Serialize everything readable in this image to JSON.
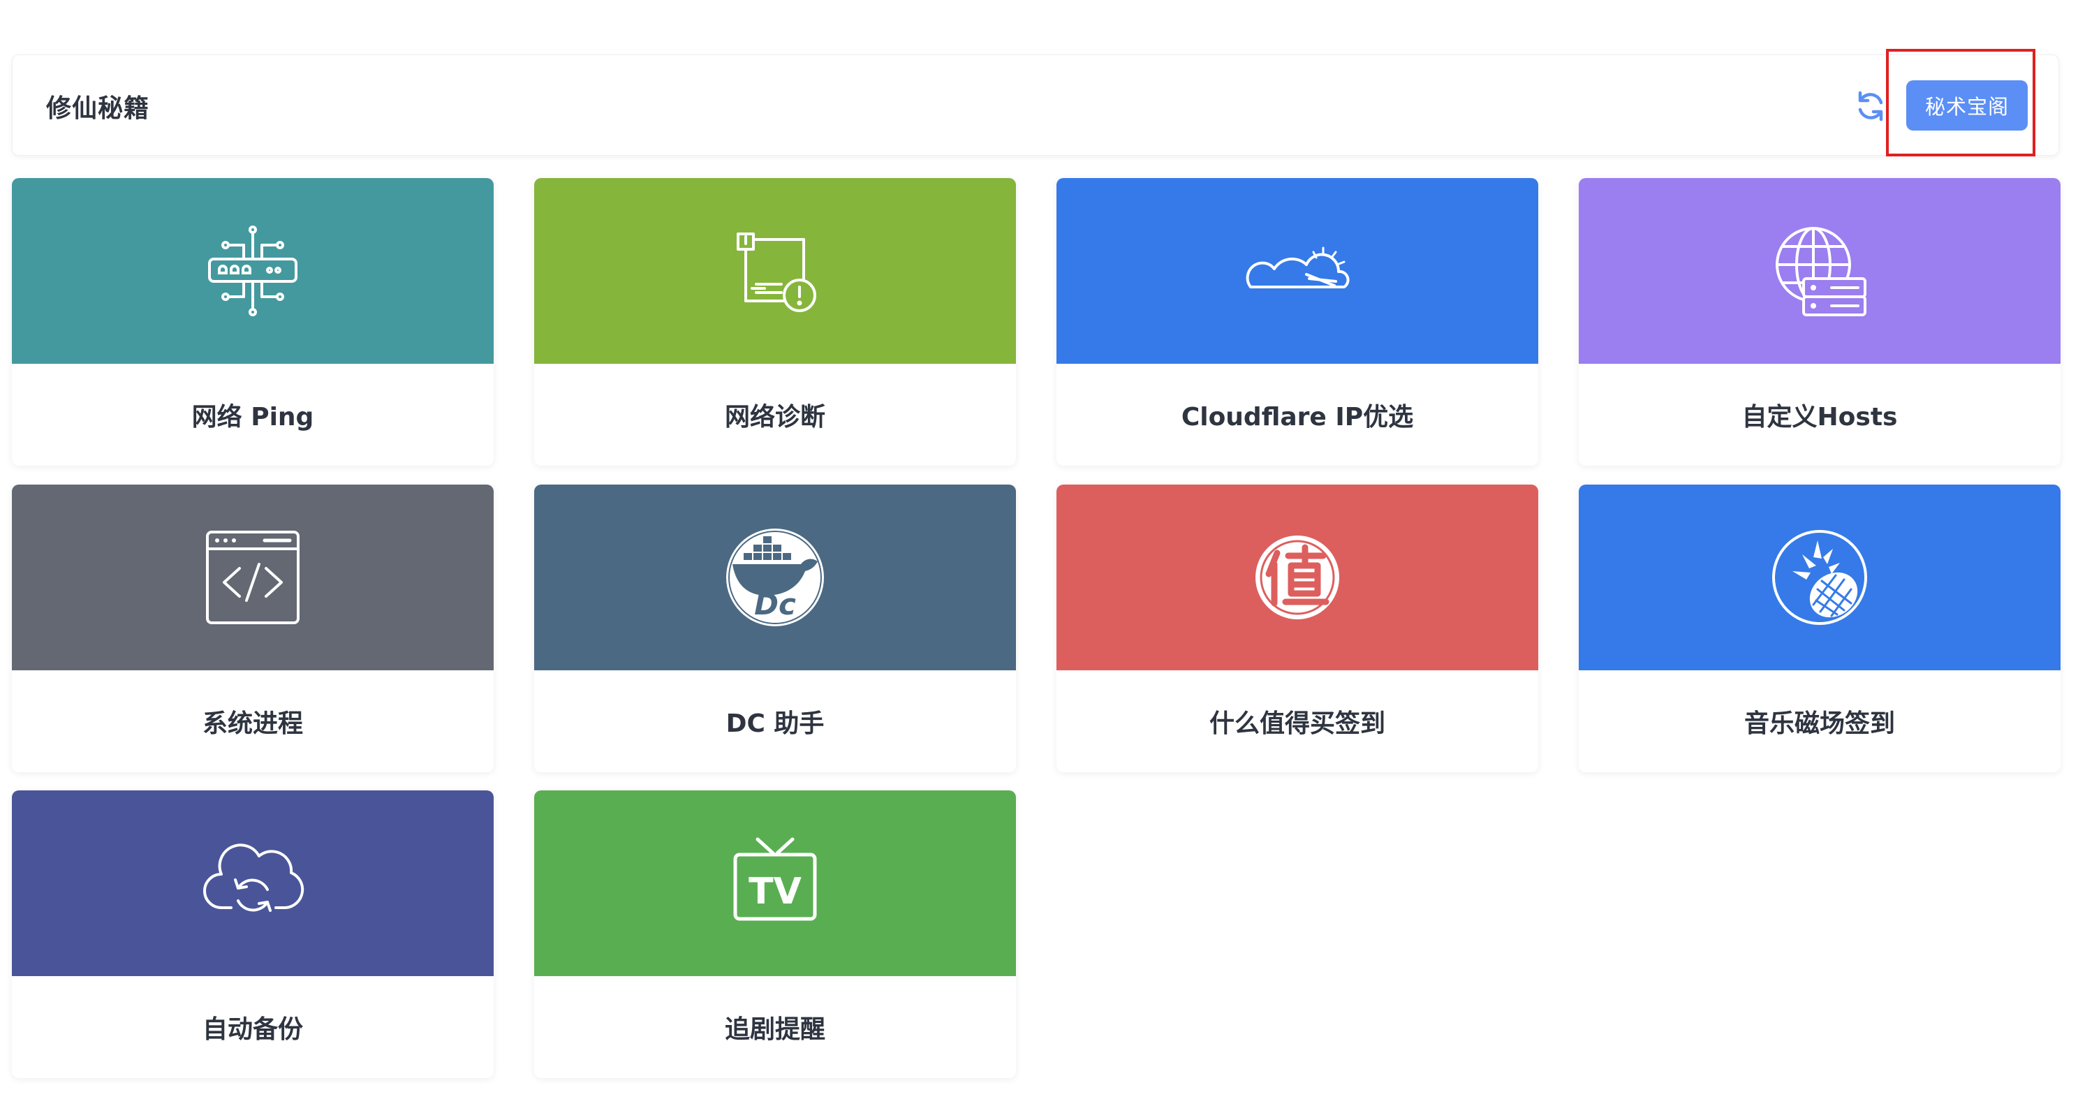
{
  "header": {
    "title": "修仙秘籍",
    "refresh_icon": "refresh-icon",
    "vault_button_label": "秘术宝阁"
  },
  "colors": {
    "accent": "#5b8ff5",
    "highlight": "#e02020"
  },
  "cards": [
    {
      "label": "网络 Ping",
      "icon": "network-ping-icon",
      "color": "#44999f"
    },
    {
      "label": "网络诊断",
      "icon": "network-diagnosis-icon",
      "color": "#86b53c"
    },
    {
      "label": "Cloudflare IP优选",
      "icon": "cloudflare-icon",
      "color": "#357ae8"
    },
    {
      "label": "自定义Hosts",
      "icon": "globe-server-icon",
      "color": "#9b7ef0"
    },
    {
      "label": "系统进程",
      "icon": "code-window-icon",
      "color": "#646873"
    },
    {
      "label": "DC 助手",
      "icon": "docker-whale-icon",
      "color": "#4b6982"
    },
    {
      "label": "什么值得买签到",
      "icon": "smzdm-icon",
      "color": "#dc5f5e"
    },
    {
      "label": "音乐磁场签到",
      "icon": "pineapple-icon",
      "color": "#357ae8"
    },
    {
      "label": "自动备份",
      "icon": "cloud-sync-icon",
      "color": "#4a5599"
    },
    {
      "label": "追剧提醒",
      "icon": "tv-icon",
      "color": "#5aae52"
    }
  ]
}
